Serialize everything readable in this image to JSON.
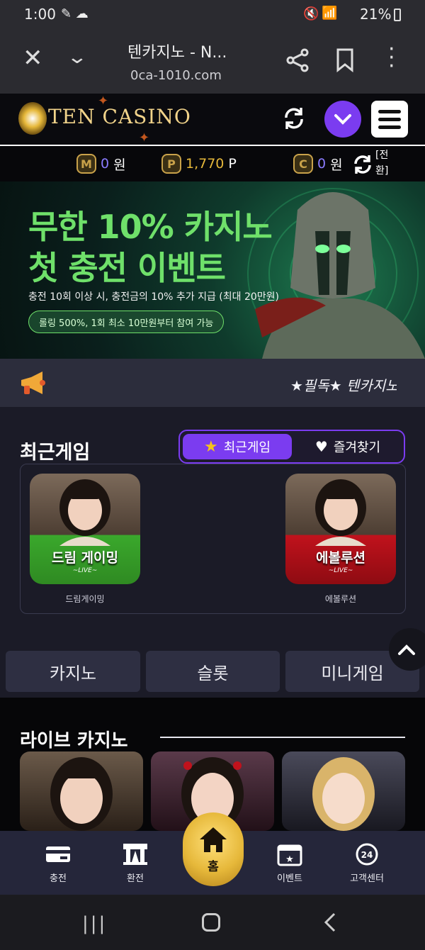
{
  "status_bar": {
    "time": "1:00",
    "battery": "21%"
  },
  "browser": {
    "tab_title": "텐카지노 - N...",
    "url": "0ca-1010.com"
  },
  "site": {
    "logo_text_1": "TEN",
    "logo_text_2": "CASINO"
  },
  "balance": {
    "m_label": "M",
    "m_value": "0",
    "m_unit": "원",
    "p_label": "P",
    "p_value": "1,770",
    "p_unit": "P",
    "c_label": "C",
    "c_value": "0",
    "c_unit": "원",
    "convert_label": "[전환]"
  },
  "banner": {
    "headline_1": "무한 10% 카지노",
    "headline_2": "첫 충전 이벤트",
    "desc": "충전 10회 이상 시, 충전금의 10% 추가 지급 (최대 20만원)",
    "pill": "롤링 500%, 1회 최소 10만원부터 참여 가능"
  },
  "notice": {
    "text": "★필독★ 텐카지노"
  },
  "recent": {
    "title": "최근게임",
    "tab_recent": "최근게임",
    "tab_favorites": "즐겨찾기",
    "games": [
      {
        "card_title": "드림 게이밍",
        "card_sub": "~LIVE~",
        "name": "드림게이밍",
        "color": "#3aa82c"
      },
      {
        "card_title": "에볼루션",
        "card_sub": "~LIVE~",
        "name": "에볼루션",
        "color": "#c0121c"
      }
    ]
  },
  "categories": [
    "카지노",
    "슬롯",
    "미니게임"
  ],
  "live_casino": {
    "title": "라이브 카지노"
  },
  "bottom_nav": {
    "deposit": "충전",
    "withdraw": "환전",
    "home": "홈",
    "event": "이벤트",
    "support": "고객센터"
  },
  "colors": {
    "accent_purple": "#7b3cf0",
    "gold": "#e6b83a",
    "green": "#6fe06a"
  }
}
